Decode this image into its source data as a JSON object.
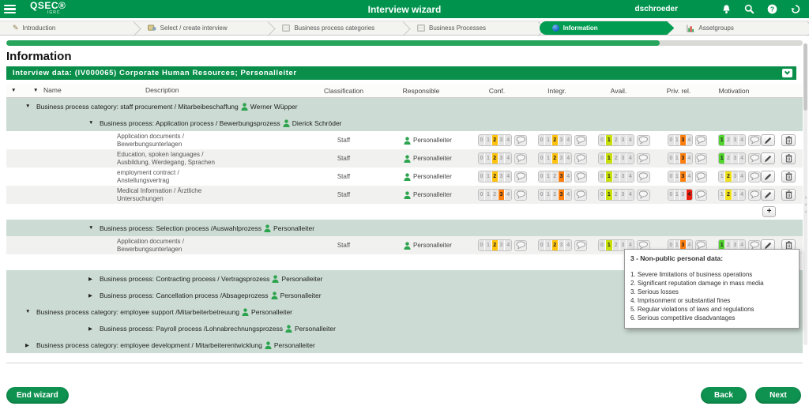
{
  "app": {
    "logo": "QSEC®",
    "logo_sub": "IGRC",
    "title": "Interview wizard",
    "user": "dschroeder"
  },
  "steps": [
    {
      "id": "introduction",
      "label": "Introduction",
      "icon": "pencil-icon",
      "active": false
    },
    {
      "id": "select-create-interview",
      "label": "Select / create interview",
      "icon": "interview-icon",
      "active": false
    },
    {
      "id": "business-process-categories",
      "label": "Business process categories",
      "icon": "category-icon",
      "active": false
    },
    {
      "id": "business-processes",
      "label": "Business Processes",
      "icon": "process-icon",
      "active": false
    },
    {
      "id": "information",
      "label": "Information",
      "icon": "info-icon",
      "active": true
    },
    {
      "id": "assetgroups",
      "label": "Assetgroups",
      "icon": "chart-icon",
      "active": false
    }
  ],
  "progress": {
    "percent": 82
  },
  "page": {
    "heading": "Information",
    "interview_bar": "Interview data: (IV000065) Corporate Human Resources; Personalleiter"
  },
  "table": {
    "headers": [
      "Name",
      "Description",
      "Classification",
      "Responsible",
      "Conf.",
      "Integr.",
      "Avail.",
      "Priv. rel.",
      "Motivation"
    ],
    "rating_scales": {
      "cia": [
        "0",
        "1",
        "2",
        "3",
        "4"
      ],
      "priv": [
        "0",
        "1",
        "3",
        "4"
      ],
      "motiv": [
        "1",
        "2",
        "3",
        "4"
      ]
    },
    "rows": [
      {
        "type": "group",
        "level": 1,
        "expanded": true,
        "label": "Business process category: staff procurement / Mitarbeibeschaffung",
        "person": "Werner Wüpper"
      },
      {
        "type": "group",
        "level": 2,
        "expanded": true,
        "label": "Business process: Application process / Bewerbungsprozess",
        "person": "Dierick Schröder"
      },
      {
        "type": "item",
        "alt": false,
        "name": [
          "Application documents /",
          "Bewerbungsunterlagen"
        ],
        "classification": "Staff",
        "responsible": "Personalleiter",
        "ratings": {
          "conf": 2,
          "integr": 2,
          "avail": 1,
          "priv": 3,
          "motiv": 1
        }
      },
      {
        "type": "item",
        "alt": true,
        "name": [
          "Education, spoken languages /",
          "Ausbildung, Werdegang, Sprachen"
        ],
        "classification": "Staff",
        "responsible": "Personalleiter",
        "ratings": {
          "conf": 2,
          "integr": 2,
          "avail": 1,
          "priv": 3,
          "motiv": 1
        }
      },
      {
        "type": "item",
        "alt": false,
        "name": [
          "employment contract /",
          "Anstellungsvertrag"
        ],
        "classification": "Staff",
        "responsible": "Personalleiter",
        "ratings": {
          "conf": 2,
          "integr": 3,
          "avail": 1,
          "priv": 3,
          "motiv": 2
        }
      },
      {
        "type": "item",
        "alt": true,
        "name": [
          "Medical Information / Ärztliche",
          "Untersuchungen"
        ],
        "classification": "Staff",
        "responsible": "Personalleiter",
        "ratings": {
          "conf": 3,
          "integr": 3,
          "avail": 1,
          "priv": 4,
          "motiv": 2
        }
      },
      {
        "type": "add"
      },
      {
        "type": "group",
        "level": 2,
        "expanded": true,
        "label": "Business process: Selection process /Auswahlprozess",
        "person": "Personalleiter"
      },
      {
        "type": "item",
        "alt": true,
        "name": [
          "Application documents /",
          "Bewerbungsunterlagen"
        ],
        "classification": "Staff",
        "responsible": "Personalleiter",
        "ratings": {
          "conf": 2,
          "integr": 2,
          "avail": 1,
          "priv": 3,
          "motiv": 1
        }
      },
      {
        "type": "add"
      },
      {
        "type": "group",
        "level": 2,
        "expanded": false,
        "label": "Business process: Contracting process / Vertragsprozess",
        "person": "Personalleiter"
      },
      {
        "type": "group",
        "level": 2,
        "expanded": false,
        "label": "Business process: Cancellation process /Absageprozess",
        "person": "Personalleiter"
      },
      {
        "type": "group",
        "level": 1,
        "expanded": true,
        "label": "Business process category: employee support /Mitarbeiterbetreuung",
        "person": "Personalleiter"
      },
      {
        "type": "group",
        "level": 2,
        "expanded": false,
        "label": "Business process: Payroll process /Lohnabrechnungsprozess",
        "person": "Personalleiter"
      },
      {
        "type": "group",
        "level": 1,
        "expanded": false,
        "label": "Business process category: employee development / Mitarbeiterentwicklung",
        "person": "Personalleiter"
      }
    ]
  },
  "tooltip": {
    "title": "3 - Non-public personal data:",
    "items": [
      "1. Severe limitations of business operations",
      "2. Significant reputation damage in mass media",
      "3. Serious losses",
      "4. Imprisonment or substantial fines",
      "5. Regular violations of laws and regulations",
      "6. Serious competitive disadvantages"
    ]
  },
  "footer": {
    "end_wizard": "End wizard",
    "back": "Back",
    "next": "Next"
  },
  "colors": {
    "brand-green": "#00934d",
    "active-green": "#009c52",
    "bar-green": "#0a8f4b",
    "progress-green": "#27a55d",
    "group-bg": "#ccdcd4",
    "button-green": "#0f9150",
    "rating-bg": "#e4e4e4",
    "rating-text": "#a3a3a3",
    "person-green": "#2ca44e",
    "value_colors": {
      "cia": {
        "1": "#c9e00d",
        "2": "#ffc20e",
        "3": "#ff7f0e",
        "4": "#ea1c0c"
      },
      "priv": {
        "3": "#ff7f0e",
        "4": "#ea1c0c"
      },
      "motiv": {
        "1": "#52d42e",
        "2": "#f0e11c"
      }
    }
  }
}
